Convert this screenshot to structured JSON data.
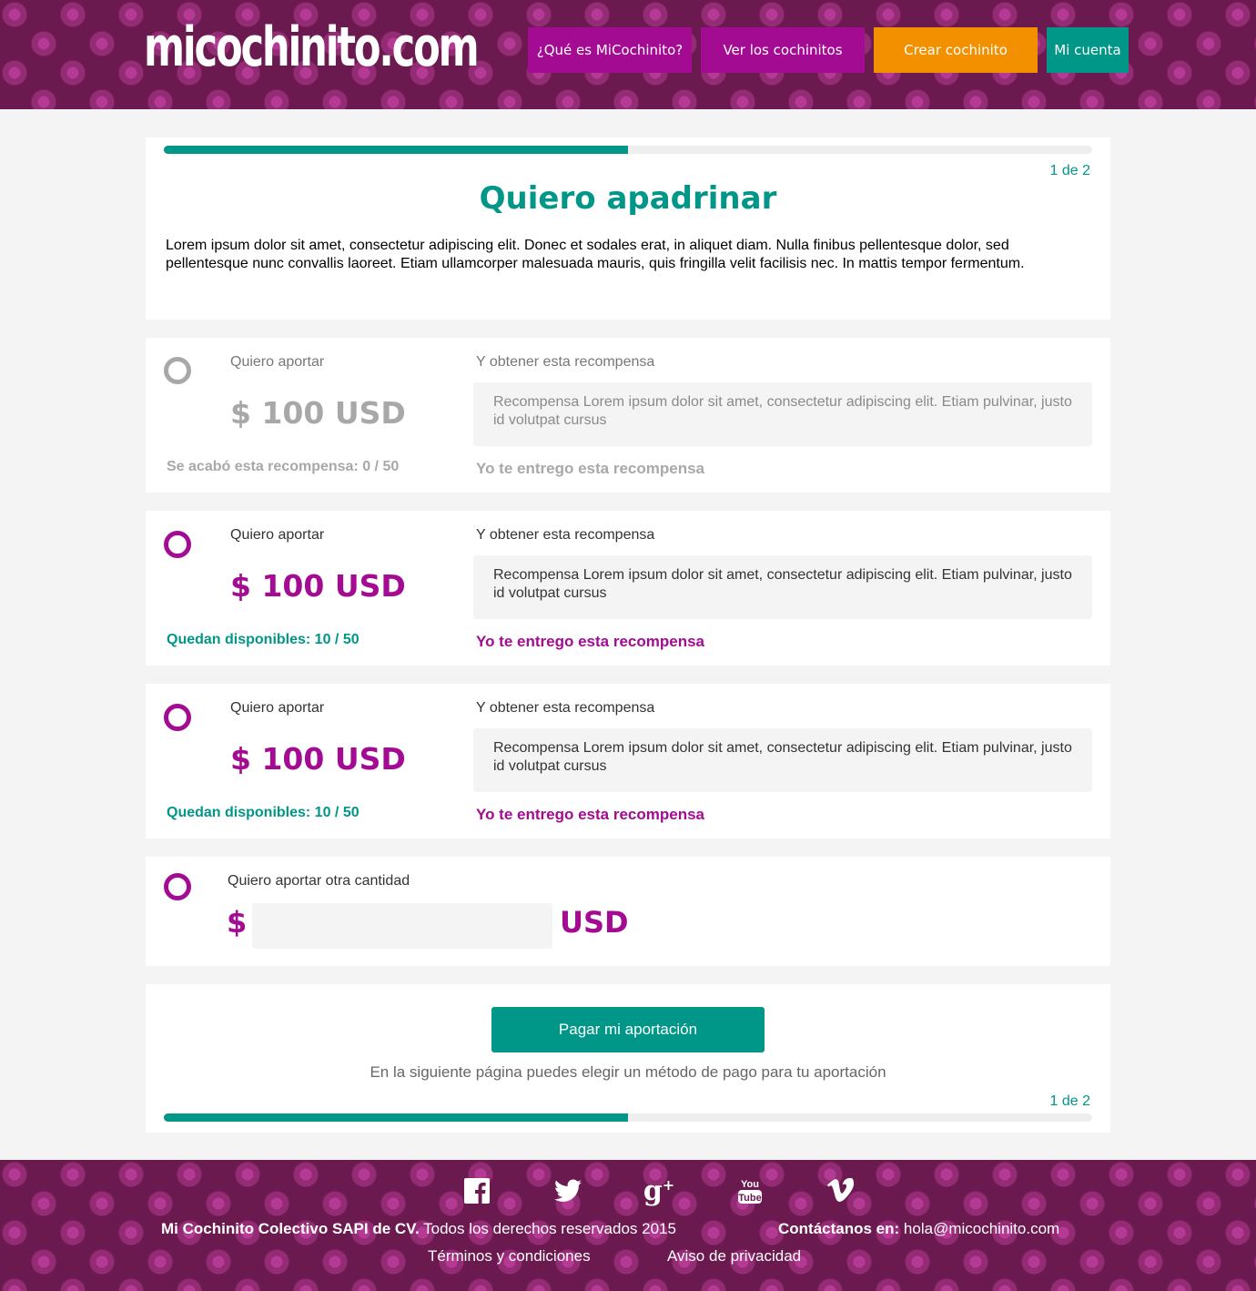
{
  "header": {
    "logo": "micochinito.com",
    "nav": {
      "que": "¿Qué es MiCochinito?",
      "ver": "Ver los cochinitos",
      "crear": "Crear cochinito",
      "cuenta": "Mi cuenta"
    }
  },
  "colors": {
    "brand_purple": "#a30b93",
    "brand_teal": "#009688",
    "brand_orange": "#f39000",
    "header_bg": "#6b1a4f"
  },
  "progress": {
    "step": "1 de 2",
    "fraction": 0.5
  },
  "intro": {
    "title": "Quiero apadrinar",
    "text": "Lorem ipsum dolor sit amet, consectetur adipiscing elit. Donec et sodales erat, in aliquet diam. Nulla finibus pellentesque dolor, sed pellentesque nunc convallis laoreet. Etiam ullamcorper malesuada mauris, quis fringilla velit facilisis nec. In mattis tempor fermentum."
  },
  "rewards": [
    {
      "label": "Quiero aportar",
      "amount": "$ 100 USD",
      "reward_label": "Y obtener esta recompensa",
      "reward_text": "Recompensa Lorem ipsum dolor sit amet, consectetur adipiscing elit. Etiam pulvinar, justo id volutpat cursus",
      "availability": "Se acabó esta recompensa: 0 / 50",
      "deliver": "Yo te entrego esta recompensa",
      "enabled": false
    },
    {
      "label": "Quiero aportar",
      "amount": "$ 100 USD",
      "reward_label": "Y obtener esta recompensa",
      "reward_text": "Recompensa Lorem ipsum dolor sit amet, consectetur adipiscing elit. Etiam pulvinar, justo id volutpat cursus",
      "availability": "Quedan disponibles: 10 / 50",
      "deliver": "Yo te entrego esta recompensa",
      "enabled": true
    },
    {
      "label": "Quiero aportar",
      "amount": "$ 100 USD",
      "reward_label": "Y obtener esta recompensa",
      "reward_text": "Recompensa Lorem ipsum dolor sit amet, consectetur adipiscing elit. Etiam pulvinar, justo id volutpat cursus",
      "availability": "Quedan disponibles: 10 / 50",
      "deliver": "Yo te entrego esta recompensa",
      "enabled": true
    }
  ],
  "other": {
    "label": "Quiero aportar otra cantidad",
    "currency_symbol": "$",
    "currency_code": "USD",
    "value": ""
  },
  "pay": {
    "button": "Pagar mi aportación",
    "note": "En la siguiente página puedes elegir un método de pago para tu aportación"
  },
  "footer": {
    "social_icons": [
      "facebook-icon",
      "twitter-icon",
      "google-plus-icon",
      "youtube-icon",
      "vimeo-icon"
    ],
    "company": "Mi Cochinito Colectivo SAPI de CV.",
    "rights": "Todos los derechos reservados 2015",
    "contact_label": "Contáctanos en:",
    "contact_email": "hola@micochinito.com",
    "terms": "Términos y condiciones",
    "privacy": "Aviso de privacidad"
  }
}
